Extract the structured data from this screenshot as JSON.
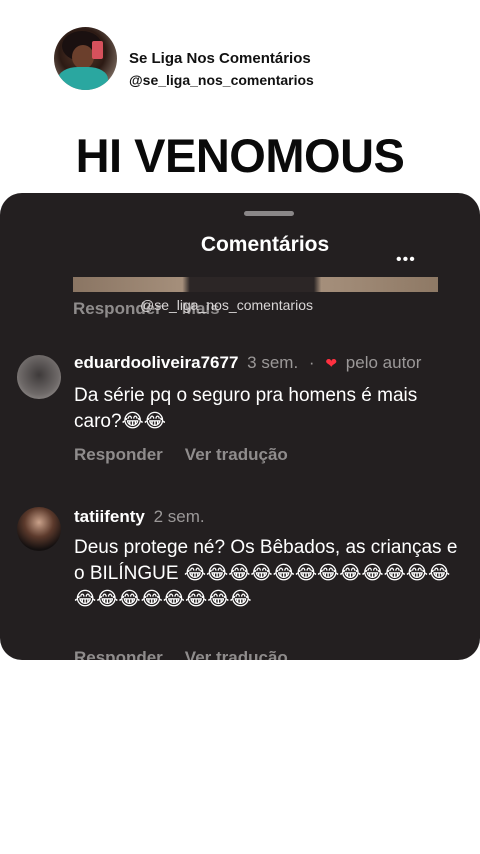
{
  "account": {
    "name": "Se Liga Nos Comentários",
    "handle": "@se_liga_nos_comentarios"
  },
  "headline": "HI VENOMOUS",
  "panel": {
    "title": "Comentários",
    "more_icon": "more-horizontal-icon",
    "previous_actions": {
      "reply": "Responder",
      "more": "Mais"
    },
    "watermark": "@se_liga_nos_comentarios"
  },
  "comments": [
    {
      "username": "eduardooliveira7677",
      "time": "3 sem.",
      "separator": "·",
      "heart_icon": "heart-icon",
      "by_author": "pelo autor",
      "text": "Da série pq o seguro pra homens é mais caro?😂😂",
      "reply": "Responder",
      "translate": "Ver tradução"
    },
    {
      "username": "tatiifenty",
      "time": "2 sem.",
      "text": "Deus protege né? Os Bêbados, as crianças e o BILÍNGUE 😂😂😂😂😂😂😂😂😂😂😂😂😂😂😂😂😂😂😂😂",
      "reply": "Responder",
      "translate": "Ver tradução"
    }
  ],
  "colors": {
    "panel_bg": "#231f20",
    "muted_text": "#8f8c8c",
    "heart": "#ff3040"
  }
}
